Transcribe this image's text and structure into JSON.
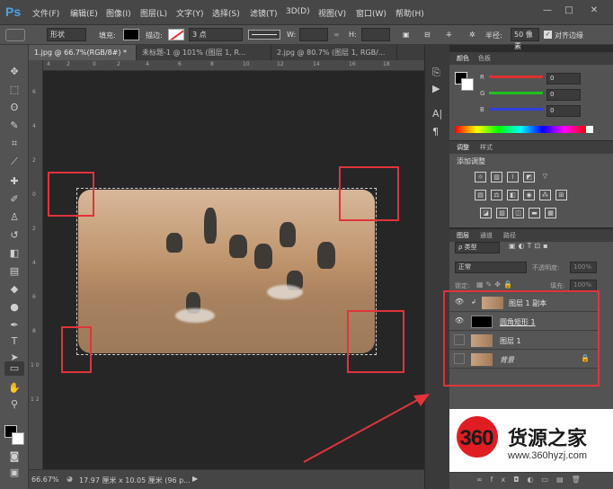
{
  "app": {
    "logo": "Ps"
  },
  "menu": [
    "文件(F)",
    "编辑(E)",
    "图像(I)",
    "图层(L)",
    "文字(Y)",
    "选择(S)",
    "滤镜(T)",
    "3D(D)",
    "视图(V)",
    "窗口(W)",
    "帮助(H)"
  ],
  "window_controls": {
    "minimize": "—",
    "restore": "□",
    "close": "✕"
  },
  "options": {
    "mode": "形状",
    "fill_label": "填充:",
    "stroke_label": "描边:",
    "stroke_size": "3 点",
    "w_label": "W:",
    "h_label": "H:",
    "radius_label": "半径:",
    "radius_value": "50 像素",
    "align_edges": "对齐边缘"
  },
  "tabs": [
    "1.jpg @ 66.7%(RGB/8#) *",
    "未标题-1 @ 101% (图层 1, R...",
    "2.jpg @ 80.7% (图层 1, RGB/..."
  ],
  "ruler_top": [
    "4",
    "2",
    "0",
    "2",
    "4",
    "6",
    "8",
    "10",
    "12",
    "14",
    "16",
    "18"
  ],
  "ruler_left": [
    "6",
    "4",
    "2",
    "0",
    "2",
    "4",
    "6",
    "8",
    "1 0",
    "1 2"
  ],
  "status": {
    "zoom": "66.67%",
    "doc": "17.97 厘米 x 10.05 厘米 (96 p..."
  },
  "color_panel": {
    "tabs": [
      "颜色",
      "色板"
    ],
    "channels": [
      {
        "label": "R",
        "value": "0",
        "color": "#e03030"
      },
      {
        "label": "G",
        "value": "0",
        "color": "#20c020"
      },
      {
        "label": "B",
        "value": "0",
        "color": "#3040e0"
      }
    ]
  },
  "adjust_panel": {
    "tabs": [
      "调整",
      "样式"
    ],
    "title": "添加调整"
  },
  "layers_panel": {
    "tabs": [
      "图层",
      "通道",
      "路径"
    ],
    "filter": "ρ 类型",
    "blend": "正常",
    "opacity_label": "不透明度:",
    "opacity_value": "100%",
    "lock_label": "锁定:",
    "fill_label": "填充:",
    "fill_value": "100%",
    "layers": [
      {
        "name": "图层 1 副本",
        "visible": true
      },
      {
        "name": "圆角矩形 1",
        "visible": true
      },
      {
        "name": "图层 1",
        "visible": false
      },
      {
        "name": "背景",
        "visible": false
      }
    ]
  },
  "watermark": {
    "logo": "360",
    "name": "货源之家",
    "url": "www.360hyzj.com"
  },
  "colors": {
    "accent_red": "#e0343a",
    "ps_blue": "#4ba3e3"
  }
}
